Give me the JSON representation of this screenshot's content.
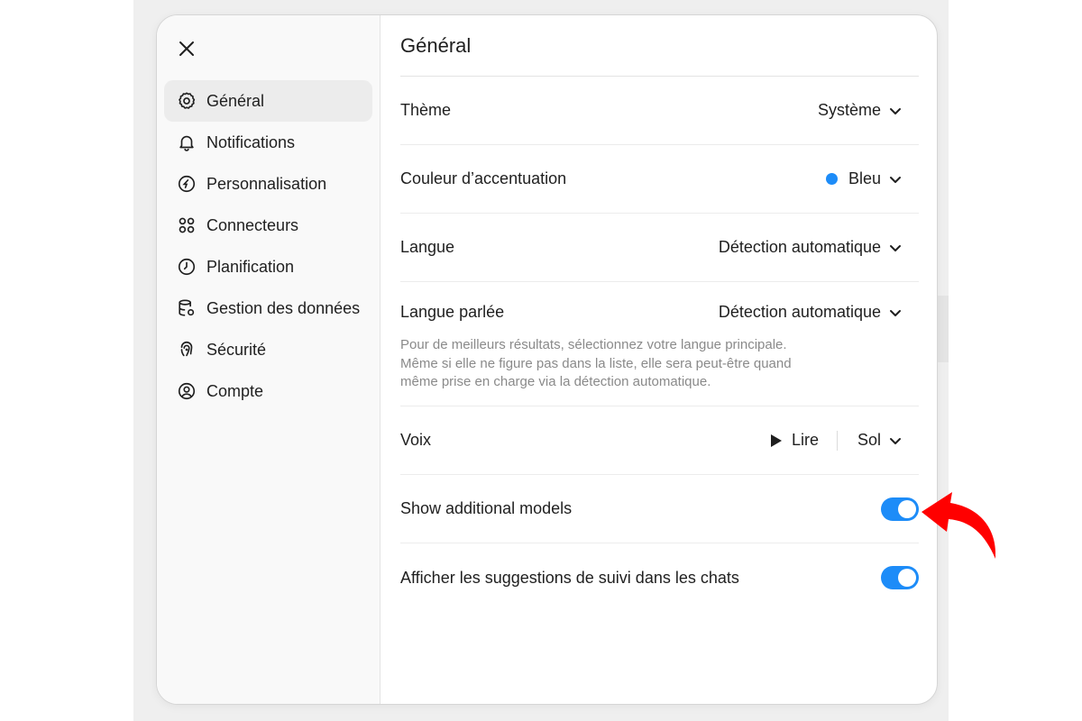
{
  "sidebar": {
    "items": [
      {
        "label": "Général",
        "icon": "gear-icon",
        "active": true
      },
      {
        "label": "Notifications",
        "icon": "bell-icon"
      },
      {
        "label": "Personnalisation",
        "icon": "personalization-icon"
      },
      {
        "label": "Connecteurs",
        "icon": "connectors-icon"
      },
      {
        "label": "Planification",
        "icon": "clock-icon"
      },
      {
        "label": "Gestion des données",
        "icon": "database-gear-icon"
      },
      {
        "label": "Sécurité",
        "icon": "fingerprint-icon"
      },
      {
        "label": "Compte",
        "icon": "user-circle-icon"
      }
    ]
  },
  "main": {
    "title": "Général",
    "theme": {
      "label": "Thème",
      "value": "Système"
    },
    "accent": {
      "label": "Couleur d’accentuation",
      "value": "Bleu",
      "color": "#1d8cf8"
    },
    "language": {
      "label": "Langue",
      "value": "Détection automatique"
    },
    "spoken_language": {
      "label": "Langue parlée",
      "value": "Détection automatique",
      "hint_lines": [
        "Pour de meilleurs résultats, sélectionnez votre langue principale.",
        "Même si elle ne figure pas dans la liste, elle sera peut-être quand",
        "même prise en charge via la détection automatique."
      ]
    },
    "voice": {
      "label": "Voix",
      "play_label": "Lire",
      "value": "Sol"
    },
    "show_models": {
      "label": "Show additional models",
      "enabled": true
    },
    "follow_up": {
      "label": "Afficher les suggestions de suivi dans les chats",
      "enabled": true
    }
  },
  "colors": {
    "accent": "#1d8cf8",
    "annotation_arrow": "#ff0000"
  }
}
